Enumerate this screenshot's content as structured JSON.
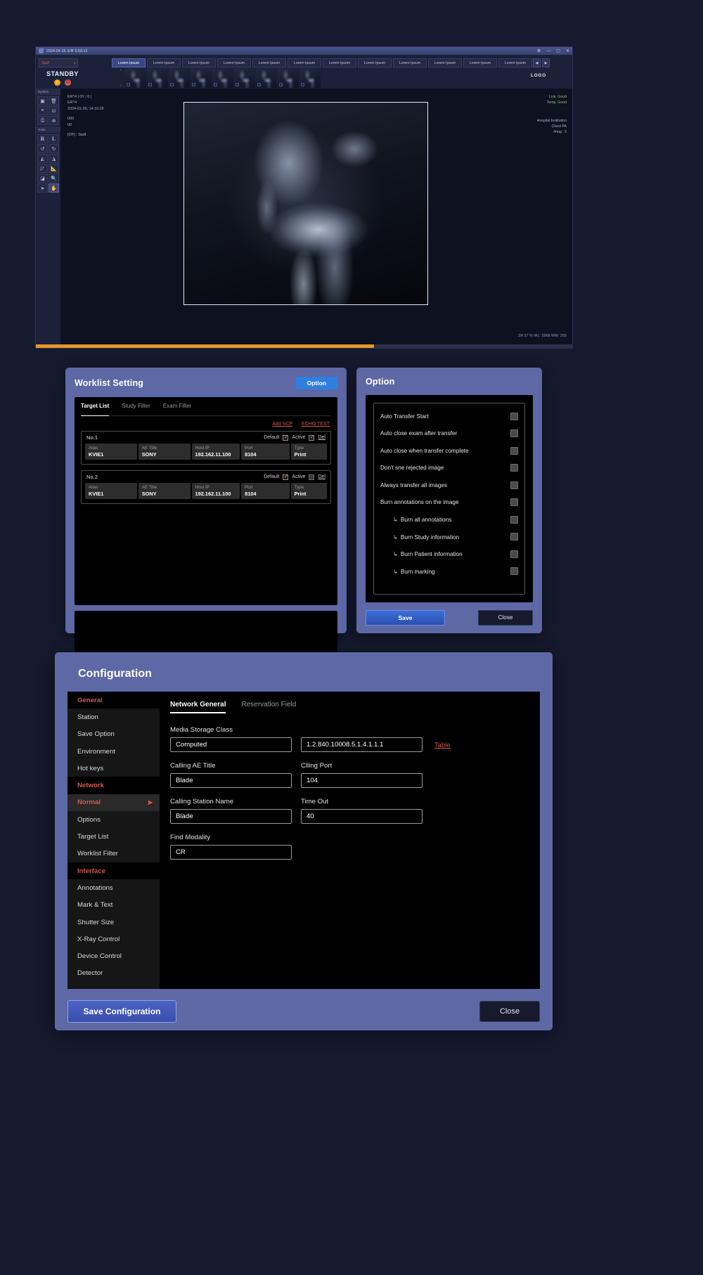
{
  "viewer": {
    "titlebar": {
      "text": "2024-04-15 오후 5:53:13",
      "app_icon": "app-icon",
      "gear": "⚙",
      "minimize": "—",
      "maximize": "▢",
      "close": "✕"
    },
    "dropdown": {
      "value": "Stuff",
      "caret": "▾"
    },
    "tabs": [
      {
        "label": "Lorem Ipsum",
        "active": true
      },
      {
        "label": "Lorem Ipsum",
        "active": false
      },
      {
        "label": "Lorem Ipsum",
        "active": false
      },
      {
        "label": "Lorem Ipsum",
        "active": false
      },
      {
        "label": "Lorem Ipsum",
        "active": false
      },
      {
        "label": "Lorem Ipsum",
        "active": false
      },
      {
        "label": "Lorem Ipsum",
        "active": false
      },
      {
        "label": "Lorem Ipsum",
        "active": false
      },
      {
        "label": "Lorem Ipsum",
        "active": false
      },
      {
        "label": "Lorem Ipsum",
        "active": false
      },
      {
        "label": "Lorem Ipsum",
        "active": false
      },
      {
        "label": "Lorem Ipsum",
        "active": false
      }
    ],
    "tabnav": {
      "prev": "◀",
      "next": "▶"
    },
    "status": {
      "label": "STANDBY",
      "bolt": "⚡",
      "power": "⏻"
    },
    "thumbnav": {
      "prev": "‹",
      "next": "›"
    },
    "thumbnails": [
      {
        "selected": true
      },
      {
        "selected": false
      },
      {
        "selected": false
      },
      {
        "selected": false
      },
      {
        "selected": false
      },
      {
        "selected": false
      },
      {
        "selected": false
      },
      {
        "selected": false
      },
      {
        "selected": false
      }
    ],
    "rail": {
      "system_header": "System",
      "system_buttons": [
        {
          "icon": "camera-icon",
          "glyph": "▣"
        },
        {
          "icon": "delete-icon",
          "glyph": "🗑"
        },
        {
          "icon": "list-icon",
          "glyph": "≡"
        },
        {
          "icon": "database-icon",
          "glyph": "⛁"
        },
        {
          "icon": "print-icon",
          "glyph": "⎙"
        },
        {
          "icon": "cancel-icon",
          "glyph": "⊗"
        }
      ],
      "tools_header": "Tools",
      "tool_buttons": [
        {
          "icon": "marker-right-icon",
          "glyph": "R",
          "letter": true,
          "on": false
        },
        {
          "icon": "marker-left-icon",
          "glyph": "L",
          "letter": true,
          "on": false
        },
        {
          "icon": "rotate-ccw-icon",
          "glyph": "↺",
          "letter": false,
          "on": false
        },
        {
          "icon": "rotate-cw-icon",
          "glyph": "↻",
          "letter": false,
          "on": false
        },
        {
          "icon": "flip-horizontal-icon",
          "glyph": "◭",
          "letter": false,
          "on": false
        },
        {
          "icon": "flip-vertical-icon",
          "glyph": "◮",
          "letter": false,
          "on": false
        },
        {
          "icon": "measure-angle-icon",
          "glyph": "◸",
          "letter": false,
          "on": false
        },
        {
          "icon": "measure-length-icon",
          "glyph": "📐",
          "letter": false,
          "on": false
        },
        {
          "icon": "window-level-icon",
          "glyph": "◪",
          "letter": false,
          "on": false
        },
        {
          "icon": "magnifier-icon",
          "glyph": "🔍",
          "letter": false,
          "on": false
        },
        {
          "icon": "pointer-icon",
          "glyph": "➤",
          "letter": false,
          "on": false
        },
        {
          "icon": "pan-hand-icon",
          "glyph": "✋",
          "letter": false,
          "on": true
        }
      ]
    },
    "image_info": [
      "ER^4 | 0Y / 0 |",
      "ER^4",
      "2024-01-26, 14:16:28",
      "",
      "000",
      "00",
      "",
      "[OP] : Staff"
    ],
    "logo": "LOGO",
    "device_status": [
      "Link. Good",
      "Temp. Good"
    ],
    "study_meta": [
      "Hospital Institution",
      "Chest PA",
      "#Img : 2"
    ],
    "zoom_info": "ZR 57 %  WL: 3968  WW: 255",
    "progress_percent": 63
  },
  "worklist": {
    "title": "Worklist Setting",
    "option_button": "Option",
    "tabs": [
      {
        "label": "Target List",
        "active": true
      },
      {
        "label": "Study Filter",
        "active": false
      },
      {
        "label": "Exam Filter",
        "active": false
      }
    ],
    "links": [
      "Add SCP",
      "ECHO TEST"
    ],
    "column_labels": {
      "alias": "Alias",
      "ae_title": "AE Title",
      "host_ip": "Host IP",
      "port": "Port",
      "type": "Type"
    },
    "row_labels": {
      "default": "Default",
      "active": "Active",
      "del": "Del"
    },
    "entries": [
      {
        "no": "No.1",
        "default_checked": true,
        "active_checked": true,
        "alias": "KVIE1",
        "ae_title": "SONY",
        "host_ip": "192.162.11.100",
        "port": "8104",
        "type": "Print"
      },
      {
        "no": "No.2",
        "default_checked": true,
        "active_checked": false,
        "alias": "KVIE1",
        "ae_title": "SONY",
        "host_ip": "192.162.11.100",
        "port": "8104",
        "type": "Print"
      }
    ],
    "save_button": "Save",
    "close_button": "Close"
  },
  "option": {
    "title": "Option",
    "items": [
      {
        "label": "Auto Transfer Start",
        "sub": false,
        "checked": false
      },
      {
        "label": "Auto close exam after transfer",
        "sub": false,
        "checked": false
      },
      {
        "label": "Auto close when transfer complete",
        "sub": false,
        "checked": false
      },
      {
        "label": "Don't sne rejected image",
        "sub": false,
        "checked": false
      },
      {
        "label": "Always transfer all images",
        "sub": false,
        "checked": false
      },
      {
        "label": "Burn annotations on the image",
        "sub": false,
        "checked": false
      },
      {
        "label": "Burn all annotations",
        "sub": true,
        "checked": false
      },
      {
        "label": "Burn Study information",
        "sub": true,
        "checked": false
      },
      {
        "label": "Burn Patient information",
        "sub": true,
        "checked": false
      },
      {
        "label": "Burn marking",
        "sub": true,
        "checked": false
      }
    ],
    "sub_arrow": "↳",
    "save_button": "Save",
    "close_button": "Close"
  },
  "configuration": {
    "title": "Configuration",
    "sidebar": [
      {
        "label": "General",
        "type": "group"
      },
      {
        "label": "Station",
        "type": "item"
      },
      {
        "label": "Save Option",
        "type": "item"
      },
      {
        "label": "Environment",
        "type": "item"
      },
      {
        "label": "Hot keys",
        "type": "item"
      },
      {
        "label": "Network",
        "type": "group"
      },
      {
        "label": "Normal",
        "type": "selected",
        "caret": "▶"
      },
      {
        "label": "Options",
        "type": "item"
      },
      {
        "label": "Target List",
        "type": "item"
      },
      {
        "label": "Worklist Filter",
        "type": "item"
      },
      {
        "label": "Interface",
        "type": "group"
      },
      {
        "label": "Annotations",
        "type": "item"
      },
      {
        "label": "Mark & Text",
        "type": "item"
      },
      {
        "label": "Shutter Size",
        "type": "item"
      },
      {
        "label": "X-Ray Control",
        "type": "item"
      },
      {
        "label": "Device Control",
        "type": "item"
      },
      {
        "label": "Detector",
        "type": "item"
      }
    ],
    "tabs": [
      {
        "label": "Network General",
        "active": true
      },
      {
        "label": "Reservation Field",
        "active": false
      }
    ],
    "fields": {
      "media_storage_class_label": "Media Storage Class",
      "media_storage_class_value": "Computed",
      "media_storage_uid_value": "1.2.840.10008.5.1.4.1.1.1",
      "table_link": "Table",
      "calling_ae_title_label": "Calling AE Title",
      "calling_ae_title_value": "Blade",
      "calling_port_label": "Clling Port",
      "calling_port_value": "104",
      "calling_station_name_label": "Calling Station Name",
      "calling_station_name_value": "Blade",
      "time_out_label": "Time Out",
      "time_out_value": "40",
      "find_modality_label": "Find Modality",
      "find_modality_value": "CR"
    },
    "save_button": "Save Configuration",
    "close_button": "Close"
  },
  "colors": {
    "accent_blue": "#2f7fe0",
    "accent_red": "#d2584a",
    "modal_header": "#5d68a5",
    "progress_orange": "#e89528",
    "status_green": "#86c07c"
  }
}
